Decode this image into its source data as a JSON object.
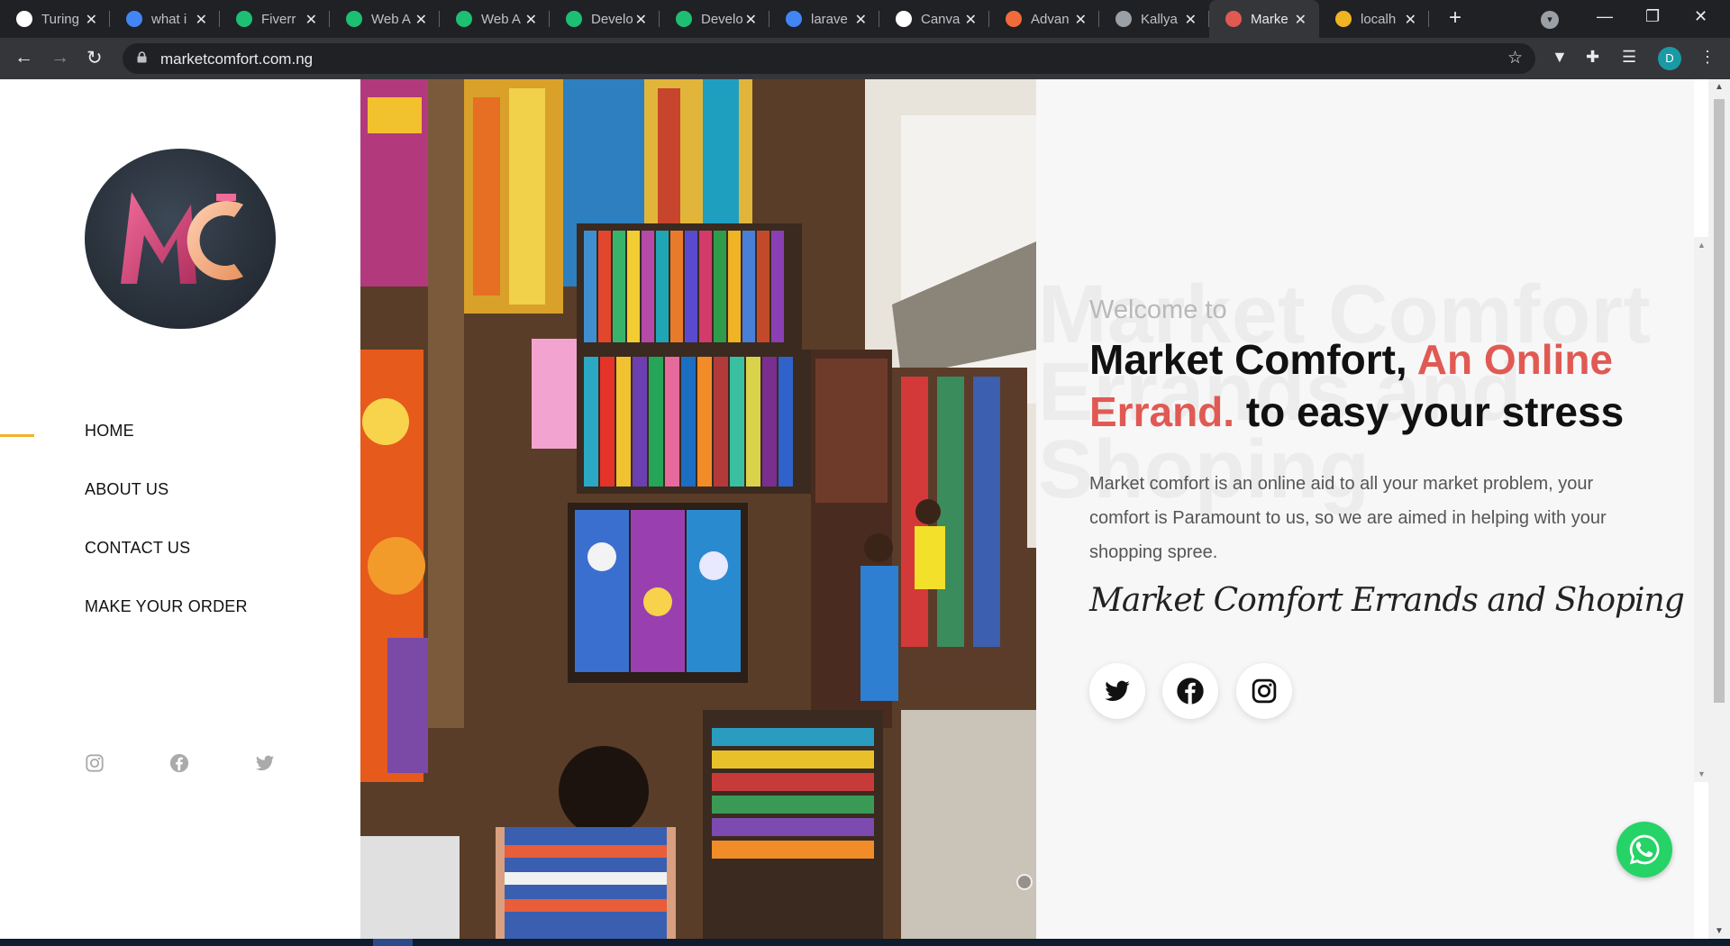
{
  "browser": {
    "tabs": [
      {
        "title": "Turing",
        "icon": "turing-icon",
        "color": "#ffffff"
      },
      {
        "title": "what i",
        "icon": "google-icon",
        "color": "#4285f4"
      },
      {
        "title": "Fiverr",
        "icon": "fiverr-icon",
        "color": "#1dbf73"
      },
      {
        "title": "Web A",
        "icon": "fiverr-icon",
        "color": "#1dbf73"
      },
      {
        "title": "Web A",
        "icon": "fiverr-icon",
        "color": "#1dbf73"
      },
      {
        "title": "Develo",
        "icon": "fiverr-icon",
        "color": "#1dbf73"
      },
      {
        "title": "Develo",
        "icon": "fiverr-icon",
        "color": "#1dbf73"
      },
      {
        "title": "larave",
        "icon": "google-icon",
        "color": "#4285f4"
      },
      {
        "title": "Canva",
        "icon": "canva-icon",
        "color": "#ffffff"
      },
      {
        "title": "Advan",
        "icon": "advan-icon",
        "color": "#f26b3a"
      },
      {
        "title": "Kallya",
        "icon": "loading-icon",
        "color": "#9aa0a6"
      },
      {
        "title": "Marke",
        "icon": "market-icon",
        "color": "#e05a53",
        "active": true
      },
      {
        "title": "localh",
        "icon": "localhost-icon",
        "color": "#f0b323"
      }
    ],
    "url": "marketcomfort.com.ng",
    "profile_initial": "D"
  },
  "sidebar": {
    "nav": [
      "HOME",
      "ABOUT US",
      "CONTACT US",
      "MAKE YOUR ORDER"
    ],
    "active_item": "HOME",
    "social": [
      "instagram-icon",
      "facebook-icon",
      "twitter-icon"
    ]
  },
  "hero": {
    "slides_count": 4,
    "active_slide": 2,
    "ghost_text": "Market Comfort Errands and Shoping",
    "welcome": "Welcome to",
    "headline_part1": "Market Comfort, ",
    "headline_accent": "An Online Errand.",
    "headline_part2": " to easy your stress",
    "description": "Market comfort is an online aid to all your market problem, your comfort is Paramount to us, so we are aimed in helping with your shopping spree.",
    "signature": "Market Comfort Errands and Shoping",
    "social": [
      "twitter-icon",
      "facebook-icon",
      "instagram-icon"
    ]
  },
  "colors": {
    "accent": "#e05a53",
    "nav_indicator": "#f0b323",
    "whatsapp": "#25d366"
  }
}
